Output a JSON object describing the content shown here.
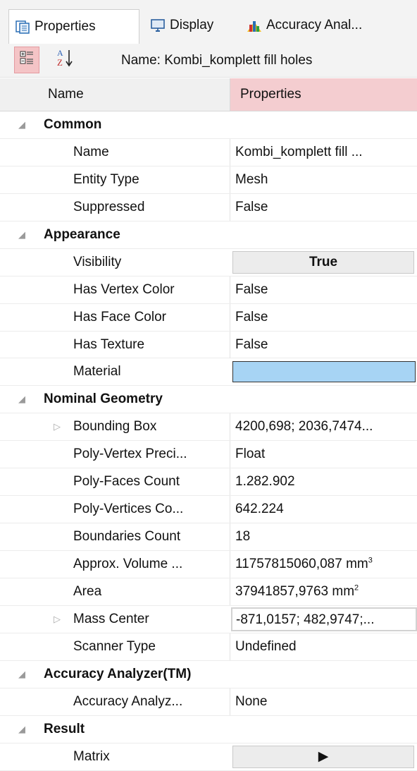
{
  "tabs": [
    {
      "label": "Properties",
      "icon": "properties-icon"
    },
    {
      "label": "Display",
      "icon": "monitor-icon"
    },
    {
      "label": "Accuracy Anal...",
      "icon": "bar-chart-icon"
    }
  ],
  "toolbar": {
    "categorized_icon": "categorized-view-icon",
    "sort_icon": "sort-az-icon",
    "name_label": "Name: Kombi_komplett fill holes"
  },
  "header": {
    "name": "Name",
    "properties": "Properties"
  },
  "groups": {
    "common": {
      "label": "Common",
      "name": {
        "name": "Name",
        "value": "Kombi_komplett fill ..."
      },
      "entity_type": {
        "name": "Entity Type",
        "value": "Mesh"
      },
      "suppressed": {
        "name": "Suppressed",
        "value": "False"
      }
    },
    "appearance": {
      "label": "Appearance",
      "visibility": {
        "name": "Visibility",
        "value": "True"
      },
      "has_vertex_color": {
        "name": "Has Vertex Color",
        "value": "False"
      },
      "has_face_color": {
        "name": "Has Face Color",
        "value": "False"
      },
      "has_texture": {
        "name": "Has Texture",
        "value": "False"
      },
      "material": {
        "name": "Material",
        "color": "#a7d4f4"
      }
    },
    "nominal_geometry": {
      "label": "Nominal Geometry",
      "bounding_box": {
        "name": "Bounding Box",
        "value": "4200,698; 2036,7474..."
      },
      "poly_vertex_precision": {
        "name": "Poly-Vertex Preci...",
        "value": "Float"
      },
      "poly_faces_count": {
        "name": "Poly-Faces Count",
        "value": "1.282.902"
      },
      "poly_vertices_count": {
        "name": "Poly-Vertices Co...",
        "value": "642.224"
      },
      "boundaries_count": {
        "name": "Boundaries Count",
        "value": "18"
      },
      "approx_volume": {
        "name": "Approx. Volume ...",
        "value": "11757815060,087 mm",
        "unit_exp": "3"
      },
      "area": {
        "name": "Area",
        "value": "37941857,9763 mm",
        "unit_exp": "2"
      },
      "mass_center": {
        "name": "Mass Center",
        "value": "-871,0157; 482,9747;..."
      },
      "scanner_type": {
        "name": "Scanner Type",
        "value": "Undefined"
      }
    },
    "accuracy_analyzer": {
      "label": "Accuracy Analyzer(TM)",
      "accuracy_analyzer": {
        "name": "Accuracy Analyz...",
        "value": "None"
      }
    },
    "result": {
      "label": "Result",
      "matrix": {
        "name": "Matrix",
        "value": "▶"
      }
    }
  }
}
